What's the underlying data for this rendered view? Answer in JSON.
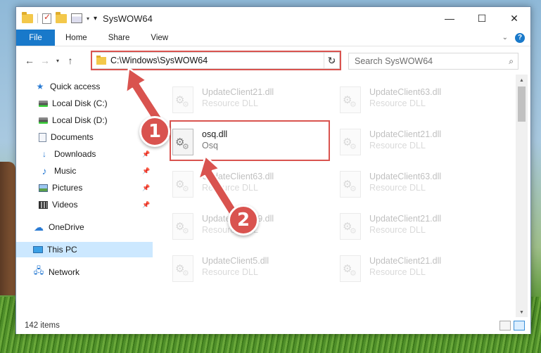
{
  "window": {
    "title": "SysWOW64",
    "controls": {
      "minimize": "—",
      "maximize": "☐",
      "close": "✕"
    }
  },
  "ribbon": {
    "tabs": [
      "File",
      "Home",
      "Share",
      "View"
    ],
    "help": "?"
  },
  "navigation": {
    "back_icon": "arrow-left",
    "forward_icon": "arrow-right",
    "recent_icon": "chevron-down",
    "up_icon": "arrow-up"
  },
  "address": {
    "path": "C:\\Windows\\SysWOW64"
  },
  "search": {
    "placeholder": "Search SysWOW64"
  },
  "sidebar": {
    "items": [
      {
        "label": "Quick access",
        "icon": "star-icon"
      },
      {
        "label": "Local Disk (C:)",
        "icon": "disk-icon"
      },
      {
        "label": "Local Disk (D:)",
        "icon": "disk-icon"
      },
      {
        "label": "Documents",
        "icon": "documents-icon"
      },
      {
        "label": "Downloads",
        "icon": "downloads-icon"
      },
      {
        "label": "Music",
        "icon": "music-icon"
      },
      {
        "label": "Pictures",
        "icon": "pictures-icon"
      },
      {
        "label": "Videos",
        "icon": "videos-icon"
      },
      {
        "label": "OneDrive",
        "icon": "cloud-icon"
      },
      {
        "label": "This PC",
        "icon": "pc-icon"
      },
      {
        "label": "Network",
        "icon": "network-icon"
      }
    ]
  },
  "files": {
    "left": [
      {
        "name": "UpdateClient21.dll",
        "type": "Resource DLL"
      },
      {
        "name": "osq.dll",
        "type": "Osq"
      },
      {
        "name": "UpdateClient63.dll",
        "type": "Resource DLL"
      },
      {
        "name": "UpdateClient19.dll",
        "type": "Resource DLL"
      },
      {
        "name": "UpdateClient5.dll",
        "type": "Resource DLL"
      }
    ],
    "right": [
      {
        "name": "UpdateClient63.dll",
        "type": "Resource DLL"
      },
      {
        "name": "UpdateClient21.dll",
        "type": "Resource DLL"
      },
      {
        "name": "UpdateClient63.dll",
        "type": "Resource DLL"
      },
      {
        "name": "UpdateClient21.dll",
        "type": "Resource DLL"
      },
      {
        "name": "UpdateClient21.dll",
        "type": "Resource DLL"
      }
    ]
  },
  "status": {
    "item_count": "142 items"
  },
  "callouts": {
    "step1": "1",
    "step2": "2",
    "color": "#d9534f"
  }
}
